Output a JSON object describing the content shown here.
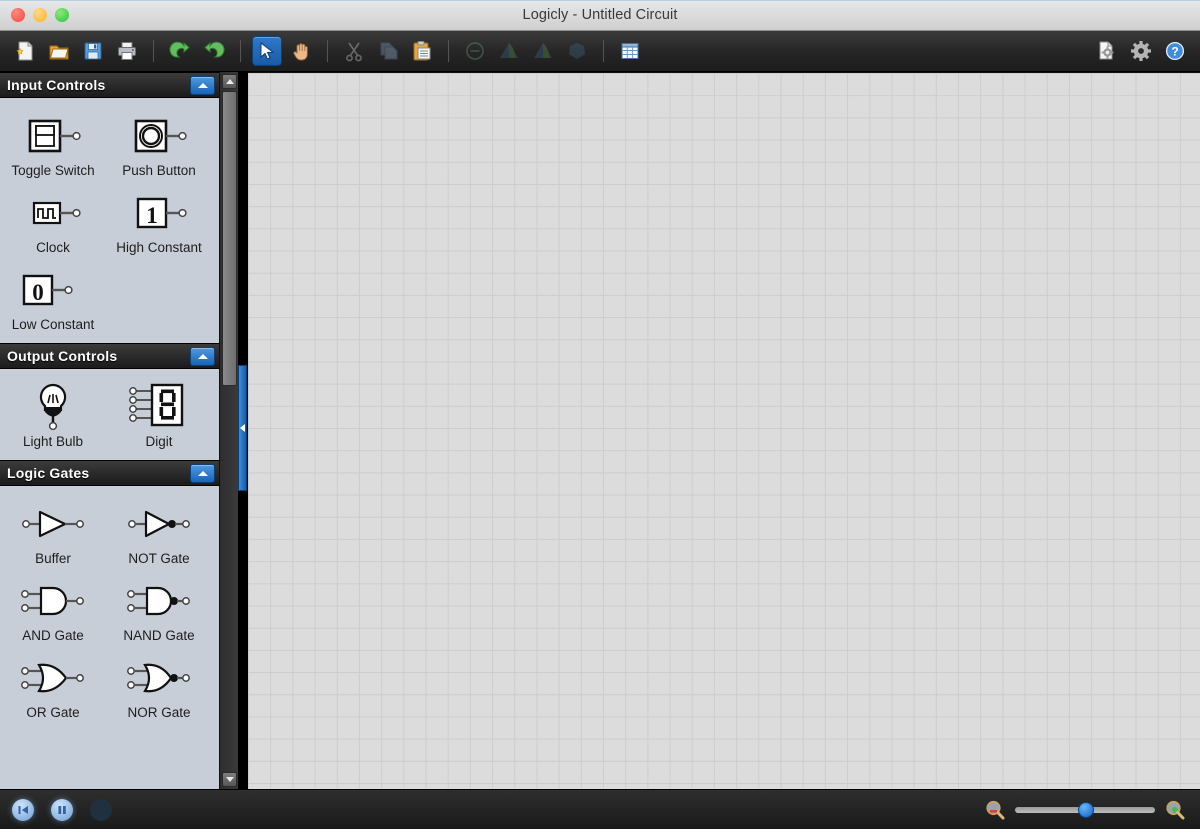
{
  "window": {
    "title": "Logicly - Untitled Circuit",
    "traffic_lights": [
      "close",
      "minimize",
      "zoom"
    ]
  },
  "toolbar": {
    "groups": [
      {
        "buttons": [
          {
            "name": "new-document-button",
            "icon": "new-file-icon",
            "label": "New",
            "enabled": true
          },
          {
            "name": "open-document-button",
            "icon": "open-folder-icon",
            "label": "Open",
            "enabled": true
          },
          {
            "name": "save-document-button",
            "icon": "save-floppy-icon",
            "label": "Save",
            "enabled": true
          },
          {
            "name": "print-button",
            "icon": "printer-icon",
            "label": "Print",
            "enabled": true
          }
        ]
      },
      {
        "buttons": [
          {
            "name": "undo-button",
            "icon": "undo-arrow-icon",
            "label": "Undo",
            "enabled": true
          },
          {
            "name": "redo-button",
            "icon": "redo-arrow-icon",
            "label": "Redo",
            "enabled": true
          }
        ]
      },
      {
        "buttons": [
          {
            "name": "select-tool-button",
            "icon": "cursor-arrow-icon",
            "label": "Select",
            "enabled": true,
            "active": true
          },
          {
            "name": "pan-tool-button",
            "icon": "hand-icon",
            "label": "Pan",
            "enabled": true
          }
        ]
      },
      {
        "buttons": [
          {
            "name": "cut-button",
            "icon": "scissors-icon",
            "label": "Cut",
            "enabled": false
          },
          {
            "name": "copy-button",
            "icon": "copy-pages-icon",
            "label": "Copy",
            "enabled": false
          },
          {
            "name": "paste-button",
            "icon": "clipboard-icon",
            "label": "Paste",
            "enabled": true
          }
        ]
      },
      {
        "buttons": [
          {
            "name": "delete-button",
            "icon": "minus-circle-icon",
            "label": "Delete",
            "enabled": false
          },
          {
            "name": "bring-forward-button",
            "icon": "bring-forward-icon",
            "label": "Bring Forward",
            "enabled": false
          },
          {
            "name": "send-backward-button",
            "icon": "send-backward-icon",
            "label": "Send Backward",
            "enabled": false
          },
          {
            "name": "group-button",
            "icon": "group-shape-icon",
            "label": "Group",
            "enabled": false
          }
        ]
      },
      {
        "buttons": [
          {
            "name": "truth-table-button",
            "icon": "table-grid-icon",
            "label": "Truth Table",
            "enabled": true
          }
        ]
      }
    ],
    "right_buttons": [
      {
        "name": "document-properties-button",
        "icon": "document-gear-icon",
        "label": "Document Properties",
        "enabled": true
      },
      {
        "name": "preferences-button",
        "icon": "gear-icon",
        "label": "Preferences",
        "enabled": true
      },
      {
        "name": "help-button",
        "icon": "help-question-icon",
        "label": "Help",
        "enabled": true
      }
    ]
  },
  "palette": {
    "sections": [
      {
        "title": "Input Controls",
        "collapse_icon": "chevron-up-icon",
        "items": [
          {
            "label": "Toggle Switch",
            "icon": "toggle-switch-icon"
          },
          {
            "label": "Push Button",
            "icon": "push-button-icon"
          },
          {
            "label": "Clock",
            "icon": "clock-waveform-icon"
          },
          {
            "label": "High Constant",
            "icon": "high-constant-icon",
            "value": "1"
          },
          {
            "label": "Low Constant",
            "icon": "low-constant-icon",
            "value": "0"
          }
        ]
      },
      {
        "title": "Output Controls",
        "collapse_icon": "chevron-up-icon",
        "items": [
          {
            "label": "Light Bulb",
            "icon": "light-bulb-icon"
          },
          {
            "label": "Digit",
            "icon": "seven-segment-digit-icon",
            "value": "8"
          }
        ]
      },
      {
        "title": "Logic Gates",
        "collapse_icon": "chevron-up-icon",
        "items": [
          {
            "label": "Buffer",
            "icon": "buffer-gate-icon"
          },
          {
            "label": "NOT Gate",
            "icon": "not-gate-icon"
          },
          {
            "label": "AND Gate",
            "icon": "and-gate-icon"
          },
          {
            "label": "NAND Gate",
            "icon": "nand-gate-icon"
          },
          {
            "label": "OR Gate",
            "icon": "or-gate-icon"
          },
          {
            "label": "NOR Gate",
            "icon": "nor-gate-icon"
          }
        ]
      }
    ]
  },
  "panel_divider": {
    "collapse_handle_icon": "chevron-left-icon",
    "name": "panel-collapse-handle"
  },
  "scrollbar": {
    "up_arrow_icon": "scroll-up-arrow-icon",
    "down_arrow_icon": "scroll-down-arrow-icon"
  },
  "canvas": {
    "grid": true,
    "background": "#dcdcdc",
    "gridline_color": "#cdcdcd"
  },
  "statusbar": {
    "transport": [
      {
        "name": "restart-simulation-button",
        "icon": "skip-back-icon",
        "enabled": true
      },
      {
        "name": "pause-simulation-button",
        "icon": "pause-icon",
        "enabled": true
      },
      {
        "name": "step-simulation-button",
        "icon": "step-icon",
        "enabled": false
      }
    ],
    "zoom": {
      "zoom_out_icon": "zoom-out-magnifier-icon",
      "zoom_in_icon": "zoom-in-magnifier-icon",
      "slider_position_percent": 50
    }
  },
  "colors": {
    "accent_blue": "#1763b5",
    "panel_bg": "#c8ced8",
    "toolbar_bg": "#252525",
    "canvas_bg": "#dcdcdc"
  }
}
